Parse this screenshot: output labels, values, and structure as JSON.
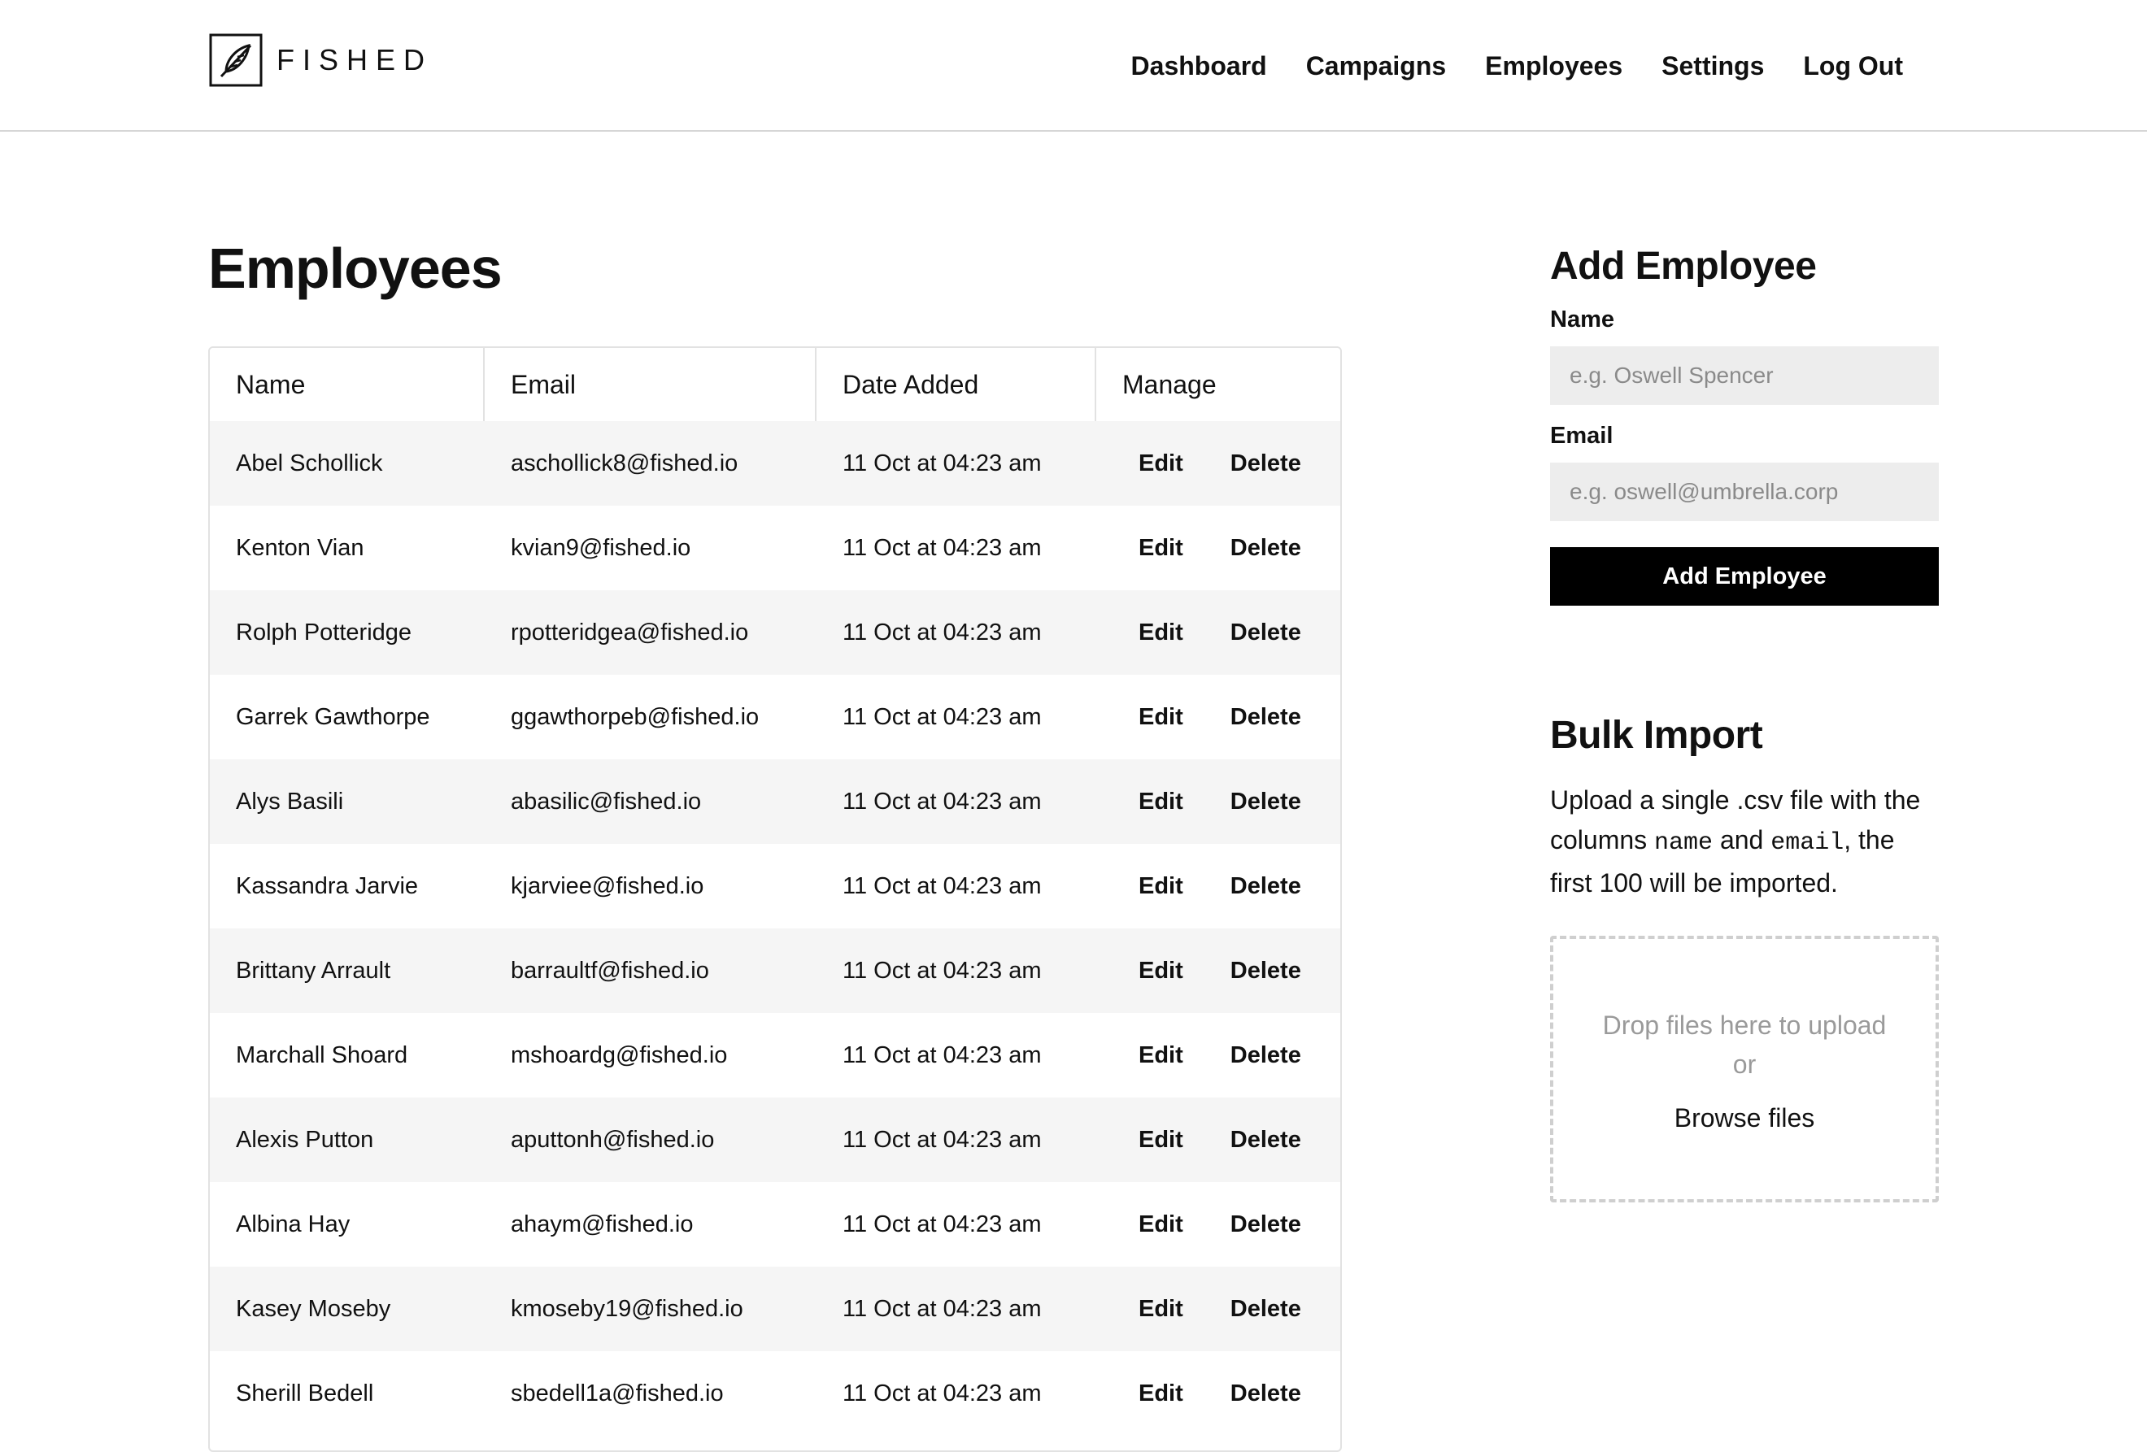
{
  "app": {
    "logo_text": "FISHED",
    "logo_icon": "feather-in-square-icon"
  },
  "nav": {
    "items": [
      {
        "label": "Dashboard"
      },
      {
        "label": "Campaigns"
      },
      {
        "label": "Employees"
      },
      {
        "label": "Settings"
      },
      {
        "label": "Log Out"
      }
    ]
  },
  "main": {
    "title": "Employees",
    "table": {
      "columns": [
        "Name",
        "Email",
        "Date Added",
        "Manage"
      ],
      "edit_label": "Edit",
      "delete_label": "Delete",
      "rows": [
        {
          "name": "Abel Schollick",
          "email": "aschollick8@fished.io",
          "date": "11 Oct at 04:23 am"
        },
        {
          "name": "Kenton Vian",
          "email": "kvian9@fished.io",
          "date": "11 Oct at 04:23 am"
        },
        {
          "name": "Rolph Potteridge",
          "email": "rpotteridgea@fished.io",
          "date": "11 Oct at 04:23 am"
        },
        {
          "name": "Garrek Gawthorpe",
          "email": "ggawthorpeb@fished.io",
          "date": "11 Oct at 04:23 am"
        },
        {
          "name": "Alys Basili",
          "email": "abasilic@fished.io",
          "date": "11 Oct at 04:23 am"
        },
        {
          "name": "Kassandra Jarvie",
          "email": "kjarviee@fished.io",
          "date": "11 Oct at 04:23 am"
        },
        {
          "name": "Brittany Arrault",
          "email": "barraultf@fished.io",
          "date": "11 Oct at 04:23 am"
        },
        {
          "name": "Marchall Shoard",
          "email": "mshoardg@fished.io",
          "date": "11 Oct at 04:23 am"
        },
        {
          "name": "Alexis Putton",
          "email": "aputtonh@fished.io",
          "date": "11 Oct at 04:23 am"
        },
        {
          "name": "Albina Hay",
          "email": "ahaym@fished.io",
          "date": "11 Oct at 04:23 am"
        },
        {
          "name": "Kasey Moseby",
          "email": "kmoseby19@fished.io",
          "date": "11 Oct at 04:23 am"
        },
        {
          "name": "Sherill Bedell",
          "email": "sbedell1a@fished.io",
          "date": "11 Oct at 04:23 am"
        }
      ]
    }
  },
  "add_employee": {
    "title": "Add Employee",
    "name_label": "Name",
    "name_placeholder": "e.g. Oswell Spencer",
    "email_label": "Email",
    "email_placeholder": "e.g. oswell@umbrella.corp",
    "submit_label": "Add Employee"
  },
  "bulk_import": {
    "title": "Bulk Import",
    "desc_1": "Upload a single .csv file with the columns ",
    "desc_code_1": "name",
    "desc_2": " and ",
    "desc_code_2": "email",
    "desc_3": ", the first 100 will be imported.",
    "drop_text": "Drop files here to upload",
    "or_text": "or",
    "browse_label": "Browse files"
  },
  "colors": {
    "accent": "#000000",
    "row_alt": "#f5f5f5",
    "input_bg": "#ededed",
    "border": "#e2e2e2"
  }
}
